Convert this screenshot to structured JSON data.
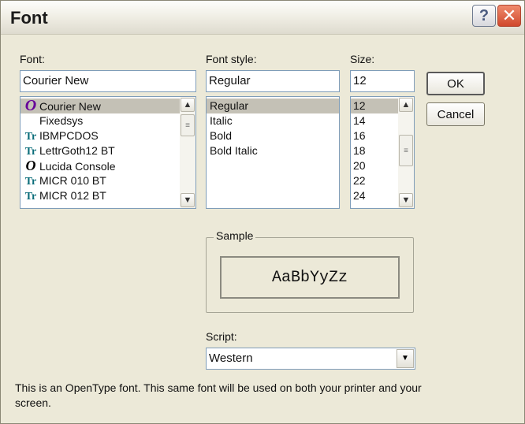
{
  "window": {
    "title": "Font",
    "help_glyph": "?",
    "close_glyph": "✕"
  },
  "font": {
    "label": "Font:",
    "value": "Courier New",
    "items": [
      {
        "name": "Courier New",
        "icon": "opentype-icon",
        "glyph": "O",
        "selected": true
      },
      {
        "name": "Fixedsys",
        "icon": "none",
        "glyph": "",
        "selected": false
      },
      {
        "name": "IBMPCDOS",
        "icon": "truetype-icon",
        "glyph": "Tr",
        "selected": false
      },
      {
        "name": "LettrGoth12 BT",
        "icon": "truetype-icon",
        "glyph": "Tr",
        "selected": false
      },
      {
        "name": "Lucida Console",
        "icon": "opentype-icon",
        "glyph": "O",
        "selected": false
      },
      {
        "name": "MICR 010 BT",
        "icon": "truetype-icon",
        "glyph": "Tr",
        "selected": false
      },
      {
        "name": "MICR 012 BT",
        "icon": "truetype-icon",
        "glyph": "Tr",
        "selected": false
      }
    ]
  },
  "style": {
    "label": "Font style:",
    "value": "Regular",
    "items": [
      "Regular",
      "Italic",
      "Bold",
      "Bold Italic"
    ]
  },
  "size": {
    "label": "Size:",
    "value": "12",
    "items": [
      "12",
      "14",
      "16",
      "18",
      "20",
      "22",
      "24"
    ]
  },
  "buttons": {
    "ok": "OK",
    "cancel": "Cancel"
  },
  "sample": {
    "label": "Sample",
    "text": "AaBbYyZz"
  },
  "script": {
    "label": "Script:",
    "value": "Western"
  },
  "description": "This is an OpenType font. This same font will be used on both your printer and your screen.",
  "scroll_glyphs": {
    "up": "▲",
    "down": "▼",
    "grip": "≡"
  }
}
